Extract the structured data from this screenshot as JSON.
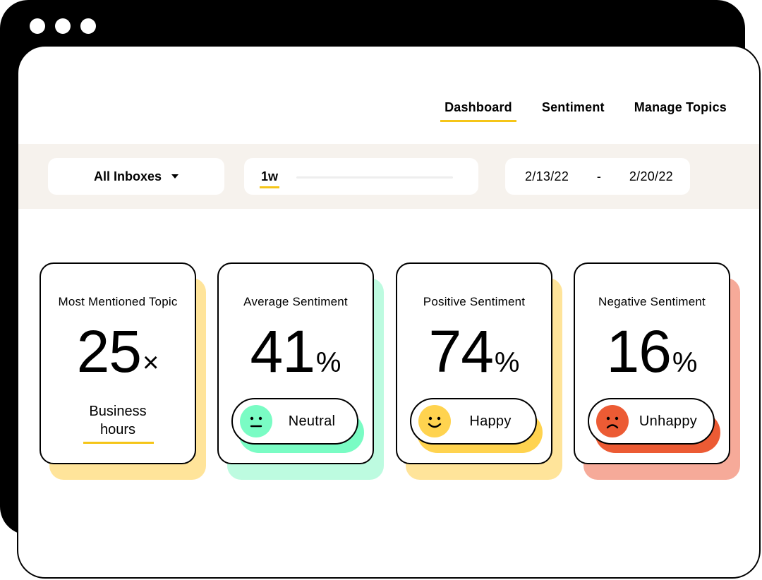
{
  "nav": [
    {
      "label": "Dashboard",
      "active": true
    },
    {
      "label": "Sentiment",
      "active": false
    },
    {
      "label": "Manage Topics",
      "active": false
    }
  ],
  "filters": {
    "inbox": "All Inboxes",
    "range": "1w",
    "start_date": "2/13/22",
    "separator": "-",
    "end_date": "2/20/22"
  },
  "cards": [
    {
      "title": "Most Mentioned Topic",
      "value": "25",
      "unit": "×",
      "topic_line1": "Business",
      "topic_line2": "hours",
      "accent": "#ffe49a"
    },
    {
      "title": "Average Sentiment",
      "value": "41",
      "unit": "%",
      "badge": "Neutral",
      "face": "neutral-face-icon",
      "accent": "#bdfbe0",
      "badge_color": "#7afcc4"
    },
    {
      "title": "Positive Sentiment",
      "value": "74",
      "unit": "%",
      "badge": "Happy",
      "face": "happy-face-icon",
      "accent": "#ffe49a",
      "badge_color": "#ffd34f"
    },
    {
      "title": "Negative Sentiment",
      "value": "16",
      "unit": "%",
      "badge": "Unhappy",
      "face": "sad-face-icon",
      "accent": "#f6aa99",
      "badge_color": "#ec5b34"
    }
  ]
}
